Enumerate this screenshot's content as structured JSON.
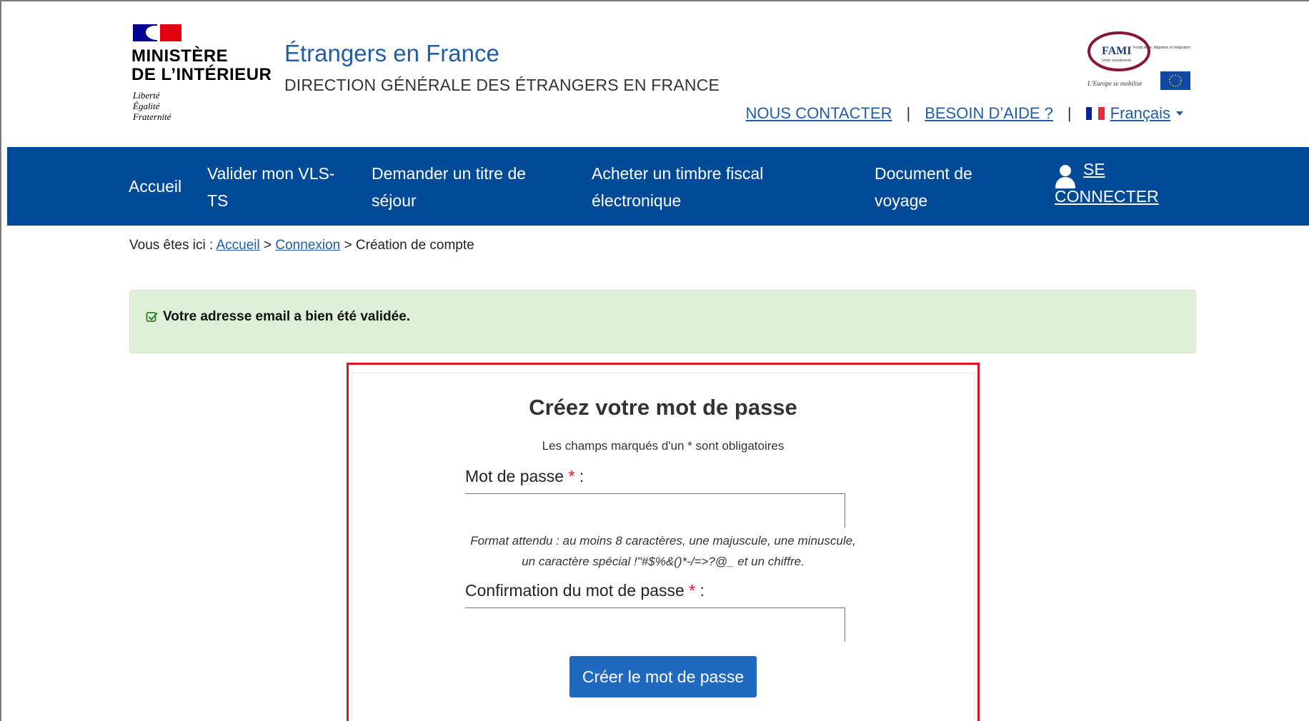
{
  "header": {
    "ministry_line1": "MINISTÈRE",
    "ministry_line2": "DE L’INTÉRIEUR",
    "motto_1": "Liberté",
    "motto_2": "Égalité",
    "motto_3": "Fraternité",
    "site_title": "Étrangers en France",
    "site_subtitle": "DIRECTION GÉNÉRALE DES ÉTRANGERS EN FRANCE",
    "fami_logo_text": "FAMI",
    "fami_logo_tag": "Fonds Asile, Migration et Intégration",
    "fami_logo_union": "Union européenne",
    "fami_logo_slogan": "L’Europe se mobilise",
    "links": {
      "contact": "NOUS CONTACTER",
      "help": "BESOIN D’AIDE ?",
      "separator": "|",
      "language": "Français"
    }
  },
  "nav": {
    "home": "Accueil",
    "validate_l1": "Valider mon VLS-",
    "validate_l2": "TS",
    "residence_l1": "Demander un titre de",
    "residence_l2": "séjour",
    "stamp_l1": "Acheter un timbre fiscal",
    "stamp_l2": "électronique",
    "travel_l1": "Document de",
    "travel_l2": "voyage",
    "login_l1": "SE",
    "login_l2": "CONNECTER"
  },
  "breadcrumb": {
    "prefix": "Vous êtes ici :",
    "home": "Accueil",
    "sep": ">",
    "login": "Connexion",
    "current": "Création de compte"
  },
  "alert": {
    "message": "Votre adresse email a bien été validée."
  },
  "form": {
    "title": "Créez votre mot de passe",
    "required_note": "Les champs marqués d'un * sont obligatoires",
    "password_label": "Mot de passe",
    "password_value": "",
    "required_star": "*",
    "colon": ":",
    "hint_line1": "Format attendu : au moins 8 caractères, une majuscule, une minuscule,",
    "hint_line2": "un caractère spécial !\"#$%&()*-/=>?@_ et un chiffre.",
    "confirm_label": "Confirmation du mot de passe",
    "confirm_value": "",
    "submit_label": "Créer le mot de passe"
  },
  "colors": {
    "nav_bg": "#004a98",
    "link": "#1f5da8",
    "alert_bg": "#dff0d8",
    "button": "#1f69c1",
    "highlight": "#e0141e"
  }
}
